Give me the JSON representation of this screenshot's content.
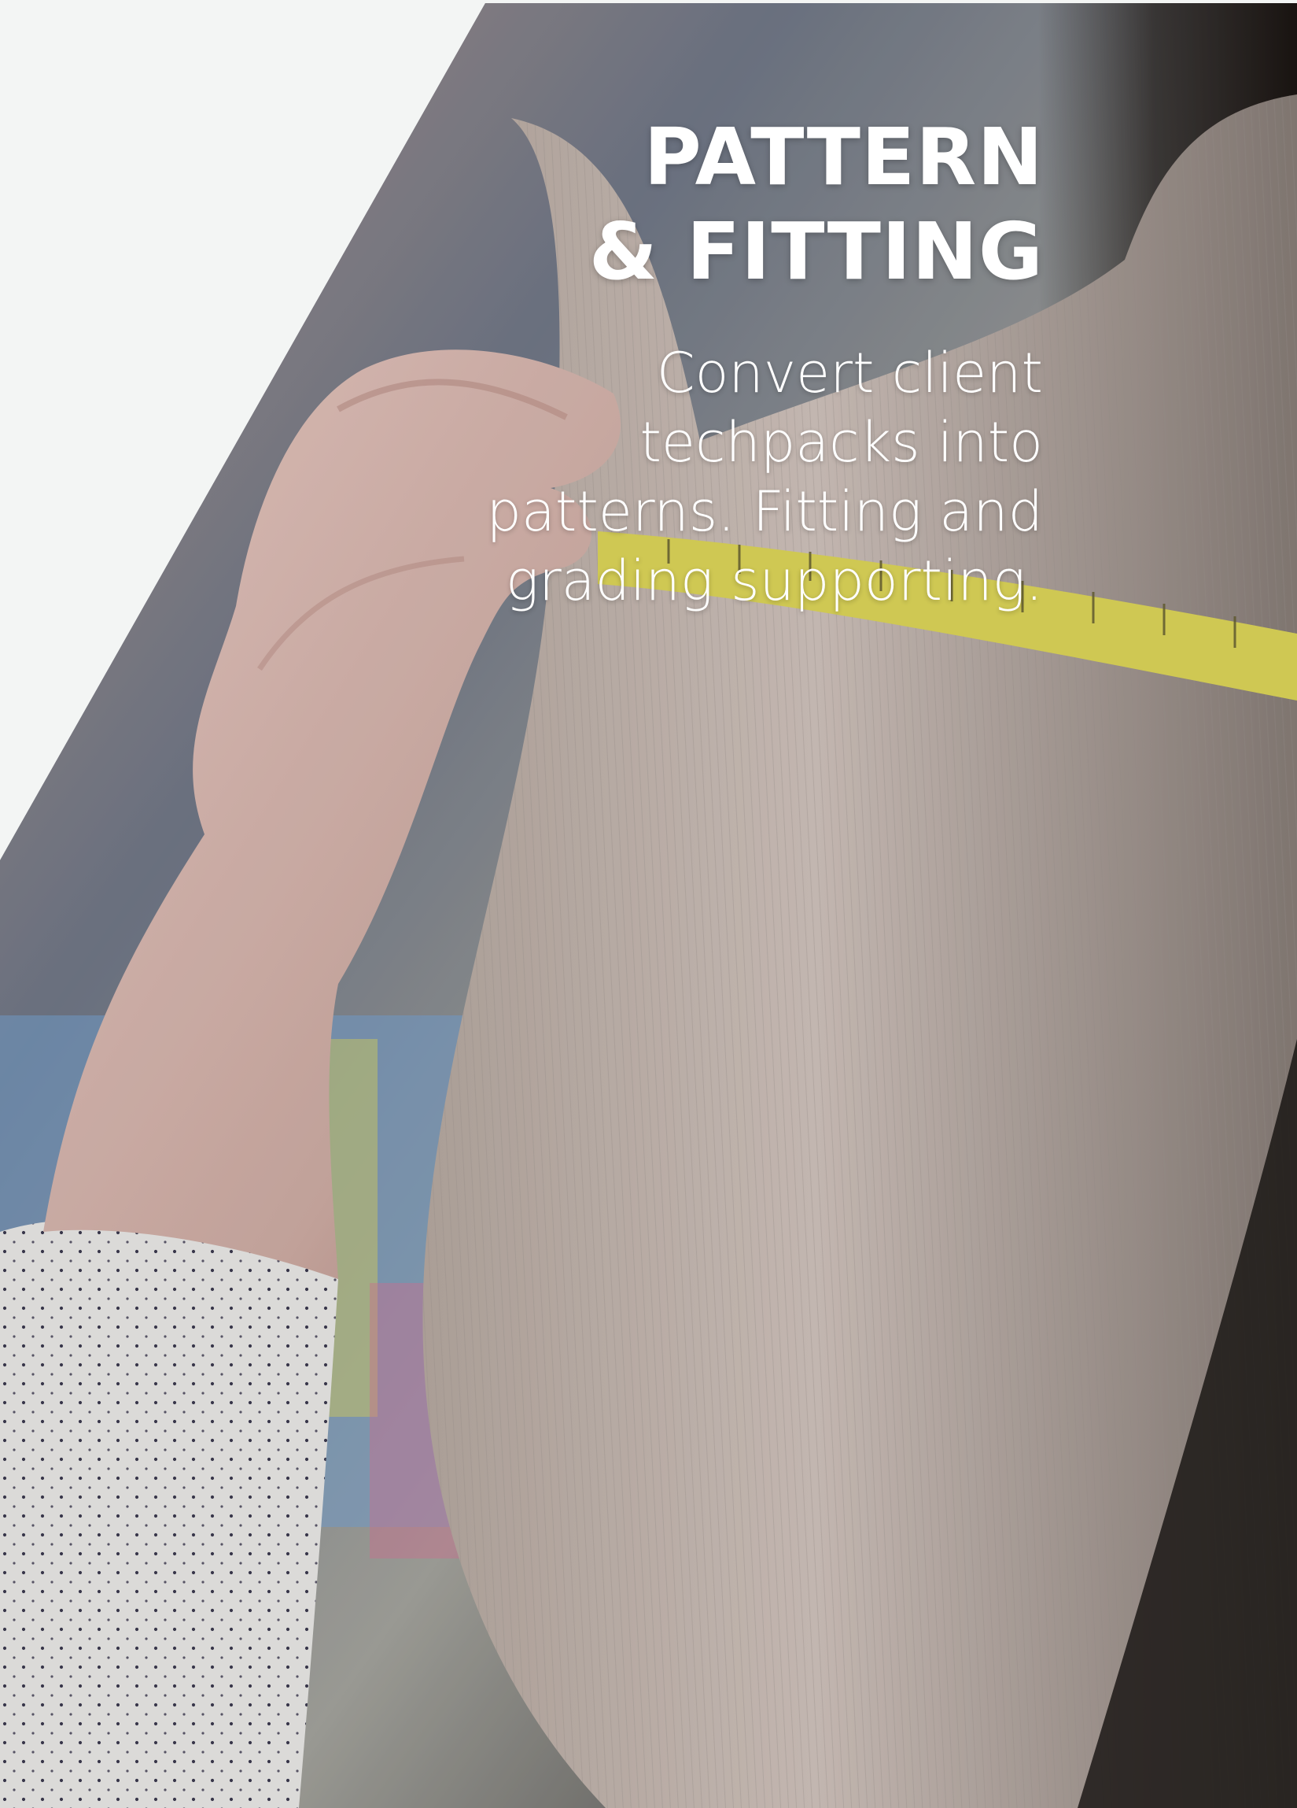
{
  "hero": {
    "title_line_1": "PATTERN",
    "title_line_2": "& FITTING",
    "description_lines": [
      "Convert client",
      "techpacks into",
      "patterns. Fitting and",
      "grading supporting."
    ]
  },
  "colors": {
    "page_background": "#f3f5f4",
    "text": "#ffffff",
    "knit_fabric": "#d8cbc4",
    "tape_measure": "#e7e45a",
    "shadow": "#17120f"
  },
  "image": {
    "description_icon": "tailor-measuring-photo-icon"
  }
}
